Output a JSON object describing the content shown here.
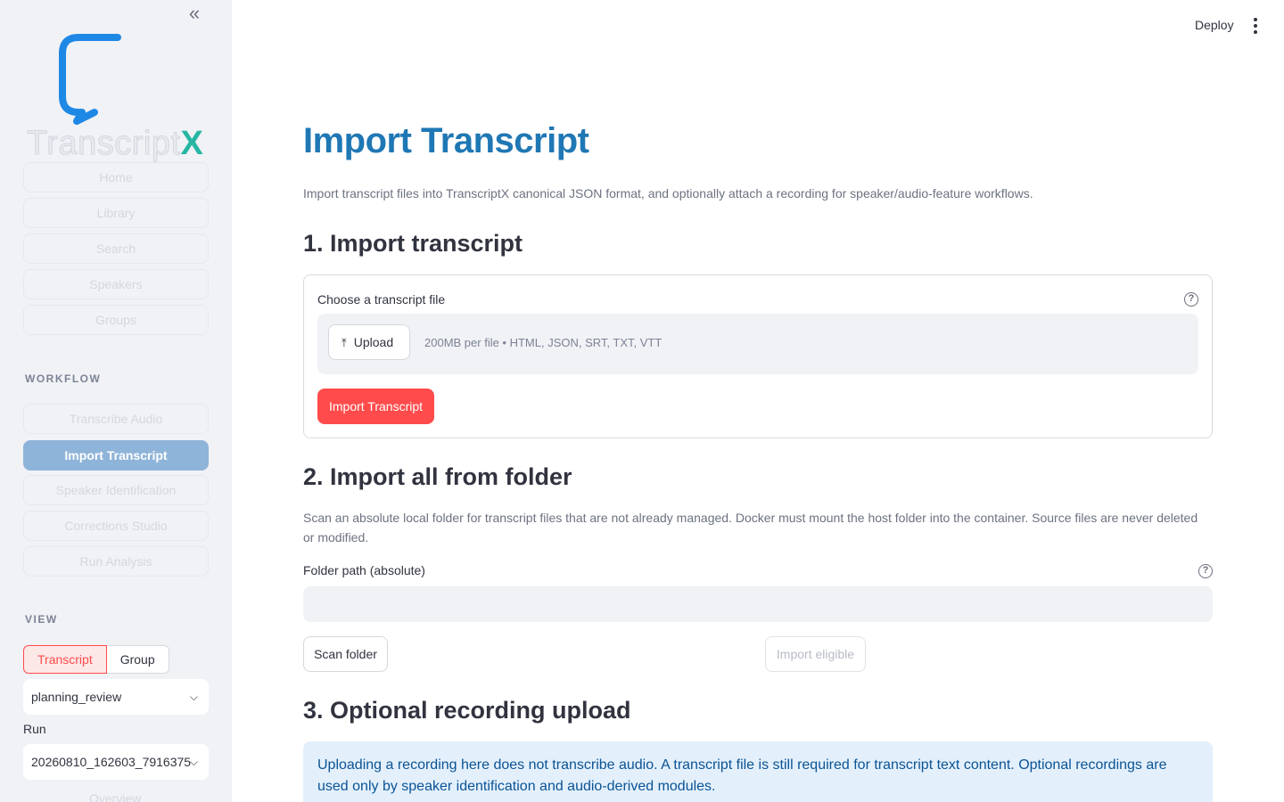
{
  "app": {
    "brand_word": "Transcript",
    "brand_x": "X",
    "collapse_glyph": "«",
    "deploy_label": "Deploy",
    "colors": {
      "accent": "#ff4b4b",
      "title_blue": "#1f77b4",
      "nav_active": "#8fb4d9",
      "info_bg": "#e3f0fc",
      "logo_blue": "#1e88e5",
      "logo_teal": "#27b6a3"
    }
  },
  "sidebar": {
    "nav_items": [
      {
        "label": "Home"
      },
      {
        "label": "Library"
      },
      {
        "label": "Search"
      },
      {
        "label": "Speakers"
      },
      {
        "label": "Groups"
      }
    ],
    "workflow_label": "WORKFLOW",
    "workflow_items": [
      {
        "label": "Transcribe Audio"
      },
      {
        "label": "Import Transcript",
        "active": true
      },
      {
        "label": "Speaker Identification"
      },
      {
        "label": "Corrections Studio"
      },
      {
        "label": "Run Analysis"
      }
    ],
    "view_label": "VIEW",
    "view_toggle": {
      "options": [
        "Transcript",
        "Group"
      ],
      "selected": "Transcript"
    },
    "transcript_select": {
      "value": "planning_review"
    },
    "run_label": "Run",
    "run_select": {
      "value": "20260810_162603_7916375"
    },
    "overview_label": "Overview"
  },
  "main": {
    "title": "Import Transcript",
    "subtitle": "Import transcript files into TranscriptX canonical JSON format, and optionally attach a recording for speaker/audio-feature workflows.",
    "section1": {
      "heading": "1. Import transcript",
      "file_label": "Choose a transcript file",
      "upload_label": "Upload",
      "limits": "200MB per file • HTML, JSON, SRT, TXT, VTT",
      "import_button": "Import Transcript"
    },
    "section2": {
      "heading": "2. Import all from folder",
      "description": "Scan an absolute local folder for transcript files that are not already managed. Docker must mount the host folder into the container. Source files are never deleted or modified.",
      "folder_label": "Folder path (absolute)",
      "folder_value": "",
      "scan_button": "Scan folder",
      "import_eligible_button": "Import eligible"
    },
    "section3": {
      "heading": "3. Optional recording upload",
      "info": "Uploading a recording here does not transcribe audio. A transcript file is still required for transcript text content. Optional recordings are used only by speaker identification and audio-derived modules."
    }
  }
}
